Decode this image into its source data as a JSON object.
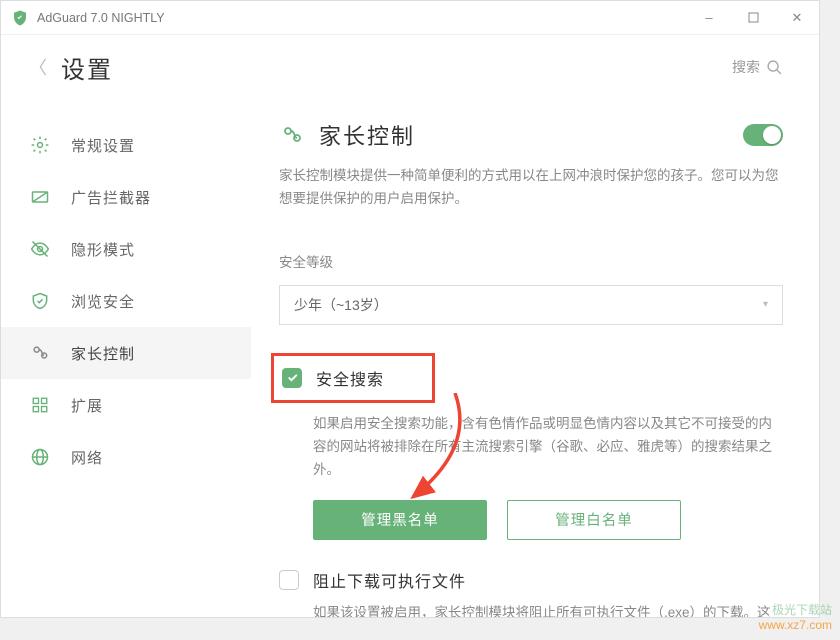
{
  "app": {
    "title": "AdGuard 7.0 NIGHTLY"
  },
  "header": {
    "page_title": "设置",
    "search_label": "搜索"
  },
  "sidebar": {
    "items": [
      {
        "label": "常规设置"
      },
      {
        "label": "广告拦截器"
      },
      {
        "label": "隐形模式"
      },
      {
        "label": "浏览安全"
      },
      {
        "label": "家长控制"
      },
      {
        "label": "扩展"
      },
      {
        "label": "网络"
      }
    ],
    "selected_index": 4
  },
  "main": {
    "title": "家长控制",
    "desc": "家长控制模块提供一种简单便利的方式用以在上网冲浪时保护您的孩子。您可以为您想要提供保护的用户启用保护。",
    "toggle_on": true,
    "level_label": "安全等级",
    "level_value": "少年（~13岁）",
    "safesearch": {
      "checked": true,
      "label": "安全搜索",
      "desc": "如果启用安全搜索功能，含有色情作品或明显色情内容以及其它不可接受的内容的网站将被排除在所有主流搜索引擎（谷歌、必应、雅虎等）的搜索结果之外。"
    },
    "buttons": {
      "blacklist": "管理黑名单",
      "whitelist": "管理白名单"
    },
    "block_exec": {
      "checked": false,
      "label": "阻止下载可执行文件",
      "desc": "如果该设置被启用，家长控制模块将阻止所有可执行文件（.exe）的下载。这将避免你的孩子在电脑上下载并安装软件。"
    }
  },
  "watermark": {
    "line1": "极光下载站",
    "line2": "www.xz7.com"
  }
}
